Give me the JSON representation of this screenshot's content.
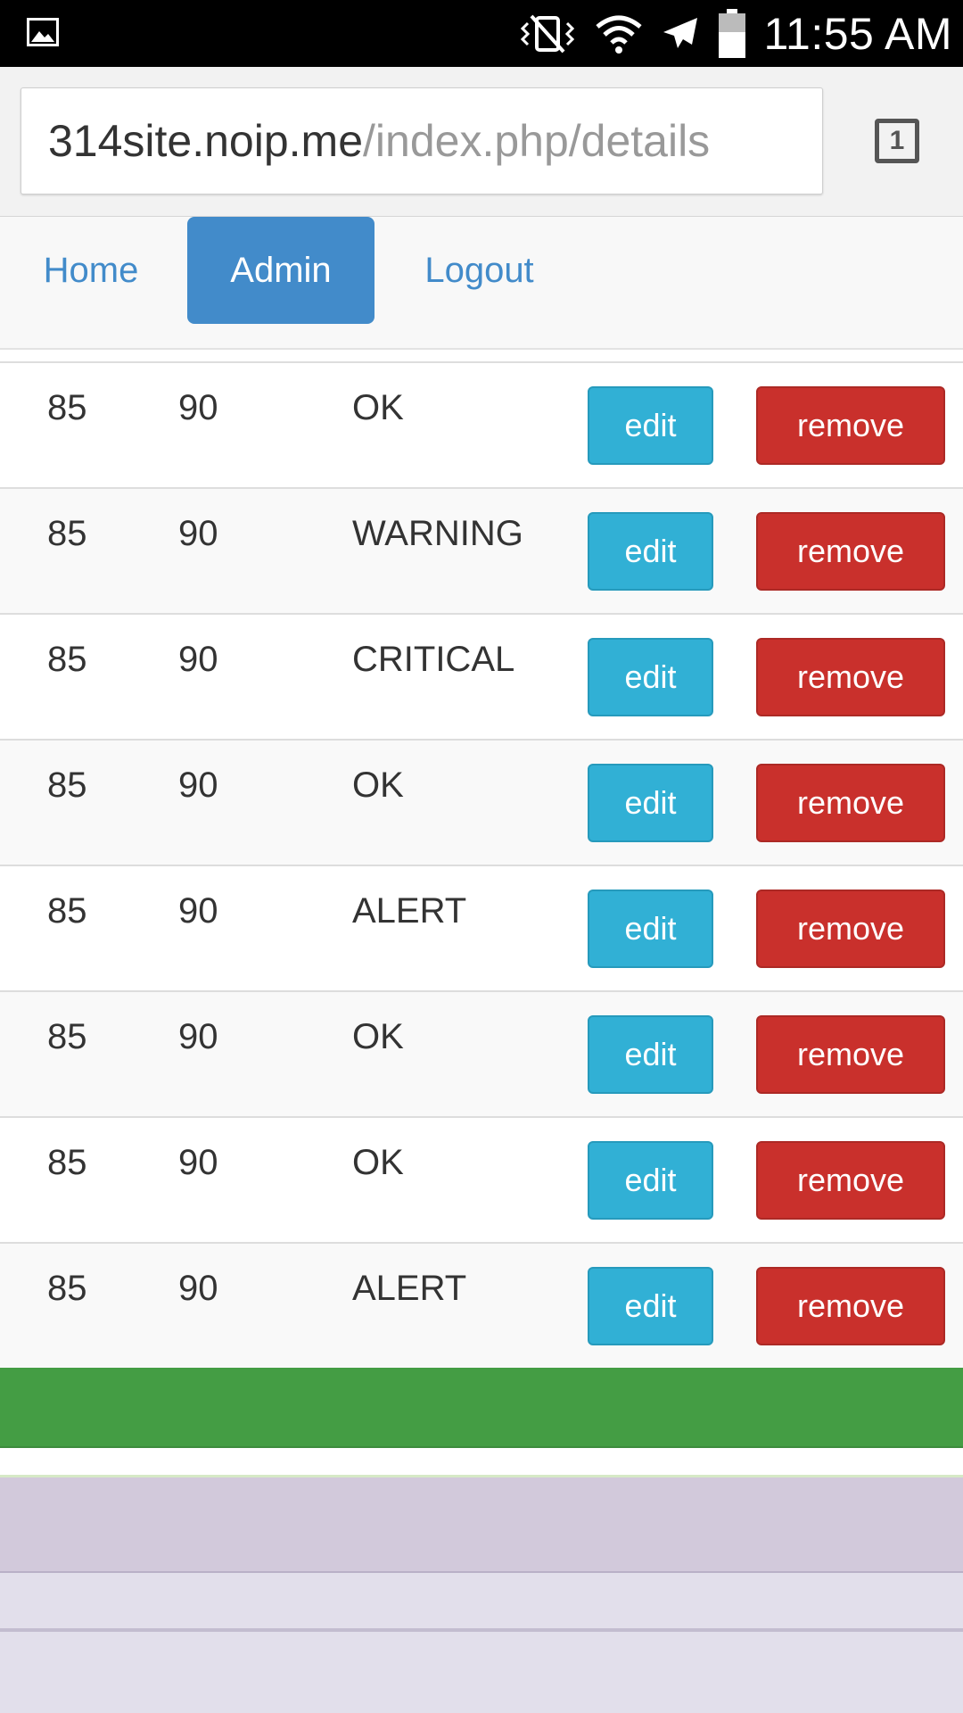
{
  "status_bar": {
    "time": "11:55 AM",
    "icons": [
      "gallery-icon",
      "vibrate-mute-icon",
      "wifi-icon",
      "airplane-icon",
      "battery-icon"
    ]
  },
  "browser": {
    "url_host": "314site.noip.me",
    "url_path": "/index.php/details",
    "tab_count": "1"
  },
  "nav": {
    "home": "Home",
    "admin": "Admin",
    "logout": "Logout",
    "active": "Admin"
  },
  "table": {
    "edit_label": "edit",
    "remove_label": "remove",
    "rows": [
      {
        "a": "85",
        "b": "90",
        "status": "OK"
      },
      {
        "a": "85",
        "b": "90",
        "status": "WARNING"
      },
      {
        "a": "85",
        "b": "90",
        "status": "CRITICAL"
      },
      {
        "a": "85",
        "b": "90",
        "status": "OK"
      },
      {
        "a": "85",
        "b": "90",
        "status": "ALERT"
      },
      {
        "a": "85",
        "b": "90",
        "status": "OK"
      },
      {
        "a": "85",
        "b": "90",
        "status": "OK"
      },
      {
        "a": "85",
        "b": "90",
        "status": "ALERT"
      }
    ]
  },
  "colors": {
    "nav_active": "#428bca",
    "edit_button": "#31b0d5",
    "remove_button": "#c9302c",
    "success_bar": "#449d44"
  }
}
